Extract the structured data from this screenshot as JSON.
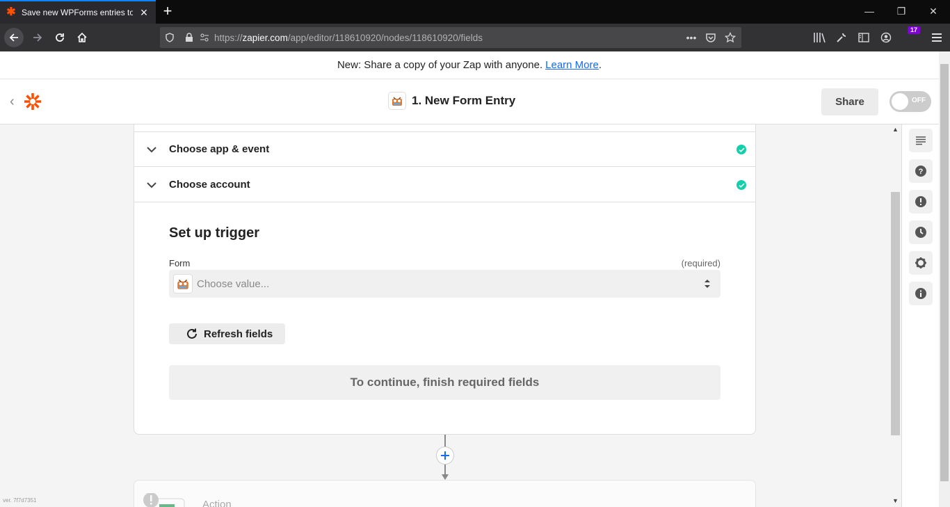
{
  "browser": {
    "tab_title": "Save new WPForms entries to a",
    "url_prefix": "https://",
    "url_host": "zapier.com",
    "url_path": "/app/editor/118610920/nodes/118610920/fields",
    "notification_count": "17"
  },
  "announcement": {
    "text": "New: Share a copy of your Zap with anyone.",
    "link": "Learn More",
    "suffix": "."
  },
  "header": {
    "title": "1. New Form Entry",
    "share_label": "Share",
    "toggle_label": "OFF"
  },
  "steps": [
    {
      "label": "Choose app & event",
      "complete": true
    },
    {
      "label": "Choose account",
      "complete": true
    }
  ],
  "setup": {
    "title": "Set up trigger",
    "field_label": "Form",
    "field_required": "(required)",
    "placeholder": "Choose value...",
    "refresh_label": "Refresh fields",
    "continue_text": "To continue, finish required fields"
  },
  "action": {
    "label": "Action"
  },
  "version": "ver. 7f7d7351",
  "colors": {
    "brand": "#ff4f00",
    "link": "#136bf5",
    "success": "#13d0ab"
  }
}
